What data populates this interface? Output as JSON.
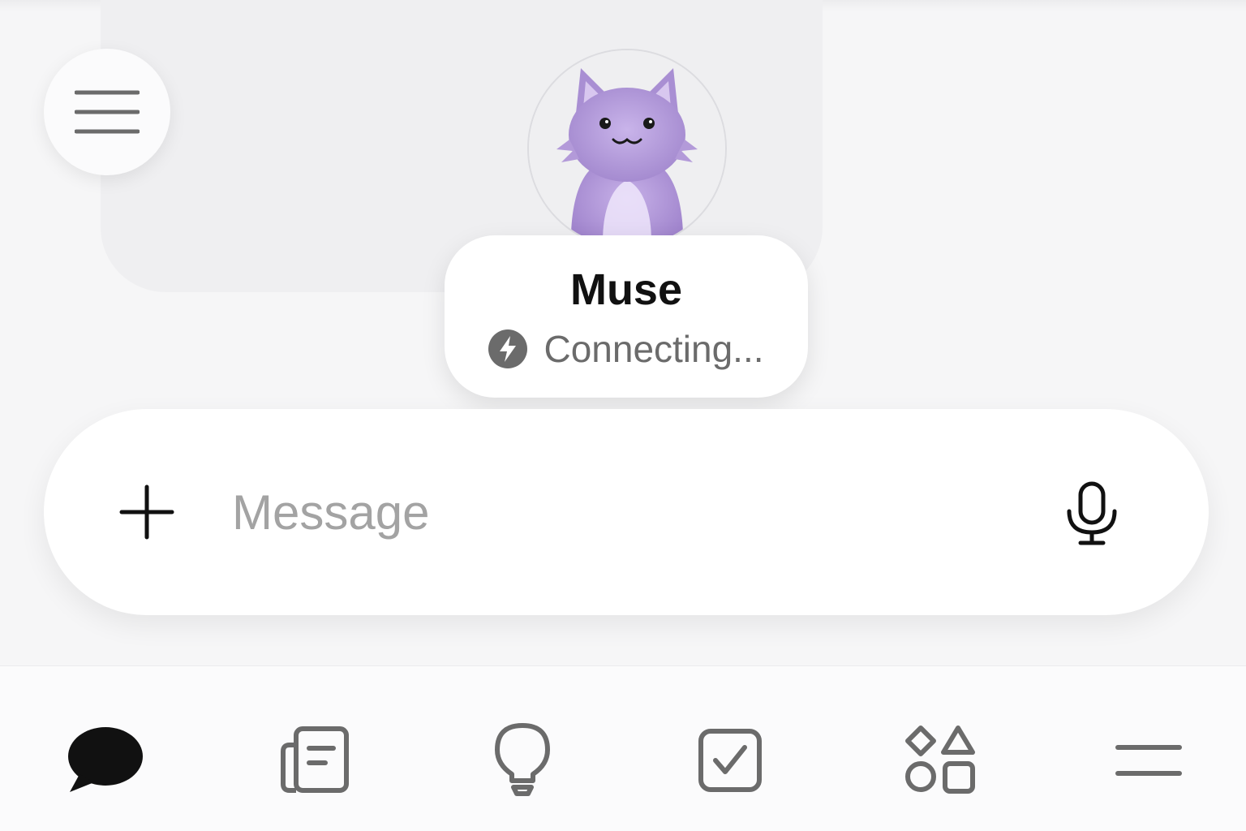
{
  "header": {
    "menu_icon": "hamburger-icon"
  },
  "assistant": {
    "name": "Muse",
    "status": "Connecting...",
    "status_icon": "lightning-bolt-icon",
    "avatar": "purple-cat-avatar"
  },
  "composer": {
    "placeholder": "Message",
    "value": "",
    "add_icon": "plus-icon",
    "mic_icon": "microphone-icon"
  },
  "nav": {
    "items": [
      {
        "icon": "chat-bubble-icon",
        "active": true
      },
      {
        "icon": "notes-icon",
        "active": false
      },
      {
        "icon": "lightbulb-icon",
        "active": false
      },
      {
        "icon": "checkbox-icon",
        "active": false
      },
      {
        "icon": "shapes-icon",
        "active": false
      },
      {
        "icon": "menu-lines-icon",
        "active": false
      }
    ]
  },
  "colors": {
    "background": "#f6f6f7",
    "surface": "#ffffff",
    "icon_gray": "#6b6b6b",
    "active_icon": "#111111",
    "placeholder": "#a3a3a3",
    "avatar_purple": "#b59ad8"
  }
}
